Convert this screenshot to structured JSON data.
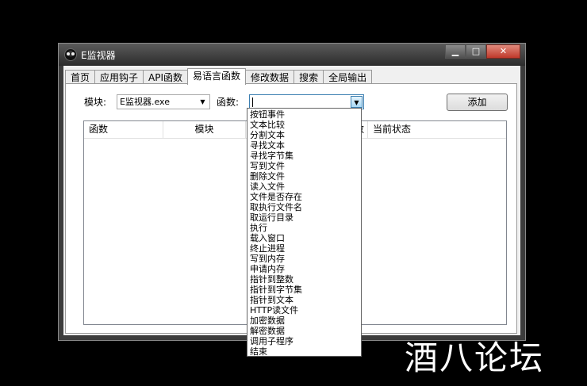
{
  "window": {
    "title": "E监视器"
  },
  "tabs": [
    {
      "label": "首页",
      "active": false
    },
    {
      "label": "应用钩子",
      "active": false
    },
    {
      "label": "API函数",
      "active": false
    },
    {
      "label": "易语言函数",
      "active": true
    },
    {
      "label": "修改数据",
      "active": false
    },
    {
      "label": "搜索",
      "active": false
    },
    {
      "label": "全局输出",
      "active": false
    }
  ],
  "form": {
    "module_label": "模块:",
    "module_value": "E监视器.exe",
    "function_label": "函数:",
    "function_value": "",
    "add_button": "添加"
  },
  "list": {
    "columns": [
      "函数",
      "模块",
      "数",
      "当前状态"
    ]
  },
  "dropdown_options": [
    "按钮事件",
    "文本比较",
    "分割文本",
    "寻找文本",
    "寻找字节集",
    "写到文件",
    "删除文件",
    "读入文件",
    "文件是否存在",
    "取执行文件名",
    "取运行目录",
    "执行",
    "载入窗口",
    "终止进程",
    "写到内存",
    "申请内存",
    "指针到整数",
    "指针到字节集",
    "指针到文本",
    "HTTP读文件",
    "加密数据",
    "解密数据",
    "调用子程序",
    "结束"
  ],
  "watermark": "酒八论坛"
}
